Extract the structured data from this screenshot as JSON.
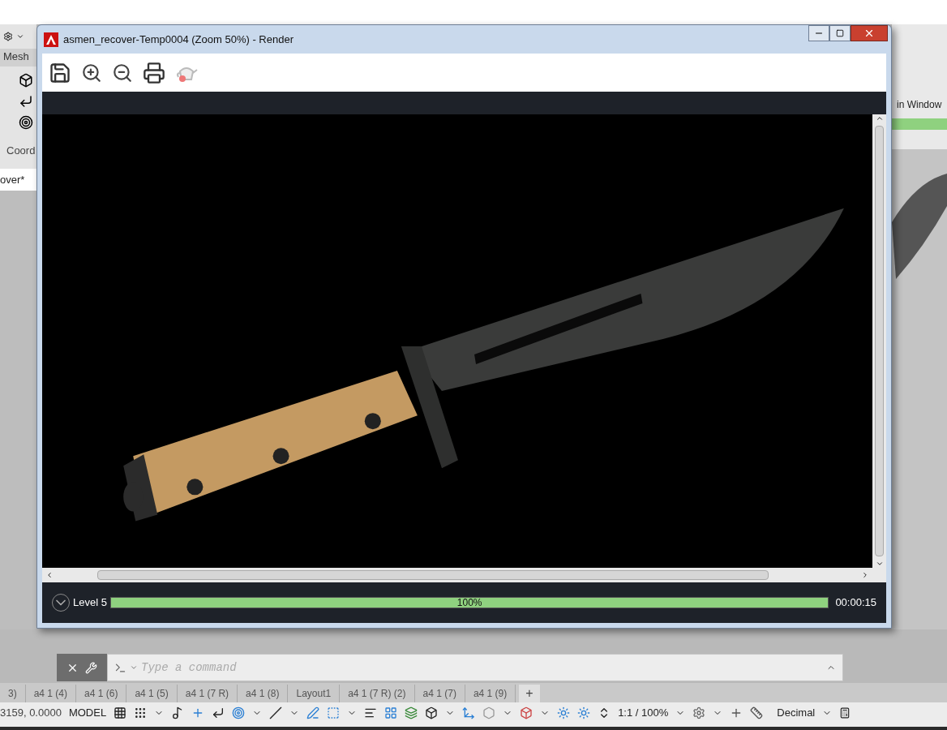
{
  "background_app": {
    "menu_tab": "Mesh",
    "panel_label": "Coord",
    "file_tab": "over*",
    "right_label": "in Window"
  },
  "render_window": {
    "title": "asmen_recover-Temp0004 (Zoom 50%) - Render",
    "level_label": "Level 5",
    "progress": {
      "level": 1.0,
      "reading": "100%"
    },
    "elapsed": "00:00:15"
  },
  "command_line": {
    "placeholder": "Type a command"
  },
  "layout_tabs": [
    {
      "label": "3)",
      "selected": false
    },
    {
      "label": "a4 1 (4)",
      "selected": false
    },
    {
      "label": "a4 1 (6)",
      "selected": false
    },
    {
      "label": "a4 1 (5)",
      "selected": false
    },
    {
      "label": "a4 1 (7 R)",
      "selected": false
    },
    {
      "label": "a4 1 (8)",
      "selected": false
    },
    {
      "label": "Layout1",
      "selected": false
    },
    {
      "label": "a4 1 (7 R) (2)",
      "selected": false
    },
    {
      "label": "a4 1 (7)",
      "selected": false
    },
    {
      "label": "a4 1 (9)",
      "selected": false
    }
  ],
  "new_tab": "+",
  "status_bar": {
    "coordinates": "3159, 0.0000",
    "space": "MODEL",
    "scale": "1:1 / 100%",
    "units": "Decimal"
  }
}
